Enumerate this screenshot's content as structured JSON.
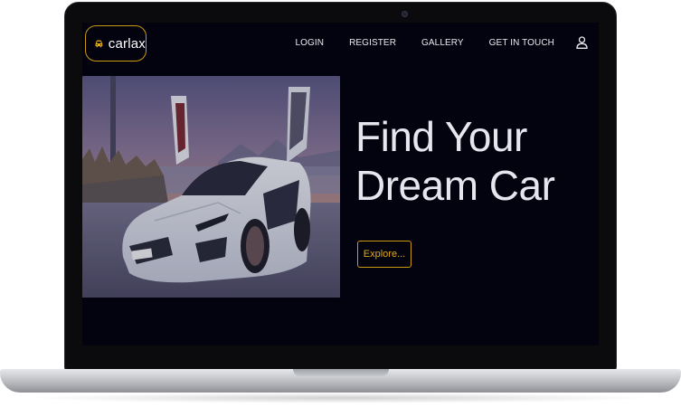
{
  "brand": {
    "name": "carlax",
    "accent": "#c99a12"
  },
  "nav": {
    "items": [
      "LOGIN",
      "REGISTER",
      "GALLERY",
      "GET IN TOUCH"
    ],
    "user_icon": "user-icon"
  },
  "hero": {
    "title_line1": "Find Your",
    "title_line2": "Dream Car",
    "cta_label": "Explore...",
    "image": "white-sports-car-photo"
  },
  "colors": {
    "background": "#03030f",
    "text": "#e6e6ee",
    "cta": "#e2a917"
  }
}
